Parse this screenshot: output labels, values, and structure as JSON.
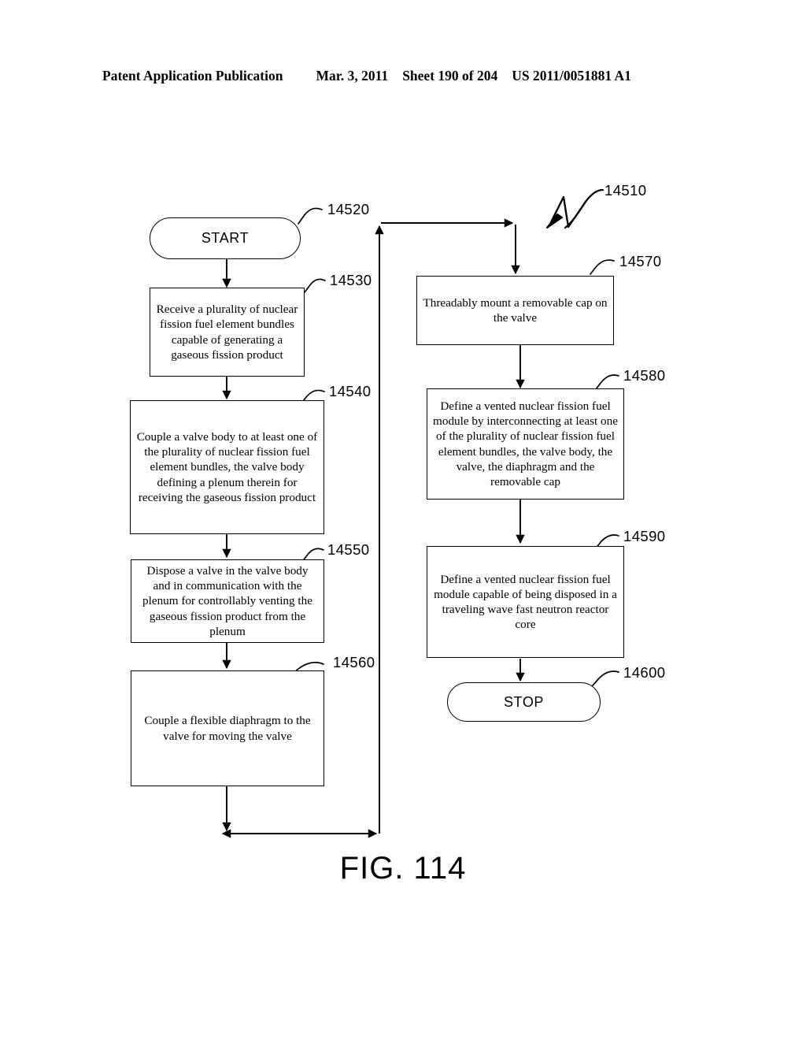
{
  "header": {
    "publication": "Patent Application Publication",
    "date": "Mar. 3, 2011",
    "sheet": "Sheet 190 of 204",
    "docnumber": "US 2011/0051881 A1"
  },
  "figure": {
    "caption": "FIG. 114",
    "diagram_label": "14510"
  },
  "nodes": {
    "start": {
      "label": "START",
      "ref": "14520"
    },
    "n14530": {
      "label": "Receive a plurality of nuclear fission fuel element bundles capable of generating a gaseous fission product",
      "ref": "14530"
    },
    "n14540": {
      "label": "Couple a valve body to at least one of the plurality of nuclear fission fuel element bundles, the valve body defining a plenum therein for receiving the gaseous fission product",
      "ref": "14540"
    },
    "n14550": {
      "label": "Dispose a valve in the valve body and in communication with the plenum for controllably venting the gaseous fission product from the plenum",
      "ref": "14550"
    },
    "n14560": {
      "label": "Couple a flexible diaphragm to the valve for moving the valve",
      "ref": "14560"
    },
    "n14570": {
      "label": "Threadably mount a removable cap on the valve",
      "ref": "14570"
    },
    "n14580": {
      "label": "Define a vented nuclear fission fuel module by interconnecting at least one of the plurality of nuclear fission fuel element bundles, the valve body, the valve, the diaphragm and the removable cap",
      "ref": "14580"
    },
    "n14590": {
      "label": "Define a vented nuclear fission fuel module capable of being disposed in a traveling wave fast neutron reactor core",
      "ref": "14590"
    },
    "stop": {
      "label": "STOP",
      "ref": "14600"
    }
  },
  "colors": {
    "ink": "#000000",
    "paper": "#ffffff"
  }
}
